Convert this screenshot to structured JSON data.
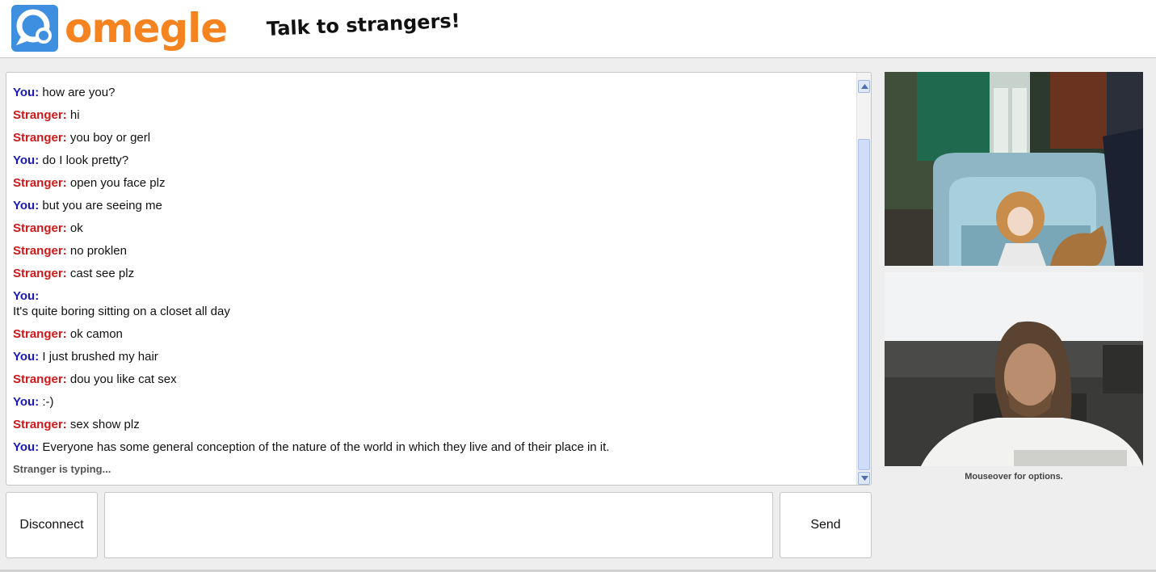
{
  "header": {
    "logo_text": "omegle",
    "tagline": "Talk to strangers!"
  },
  "chat": {
    "messages": [
      {
        "sender": "You:",
        "role": "you",
        "text": "how are you?"
      },
      {
        "sender": "Stranger:",
        "role": "stranger",
        "text": "hi"
      },
      {
        "sender": "Stranger:",
        "role": "stranger",
        "text": "you boy or gerl"
      },
      {
        "sender": "You:",
        "role": "you",
        "text": "do I look pretty?"
      },
      {
        "sender": "Stranger:",
        "role": "stranger",
        "text": "open you face plz"
      },
      {
        "sender": "You:",
        "role": "you",
        "text": "but you are seeing me"
      },
      {
        "sender": "Stranger:",
        "role": "stranger",
        "text": "ok"
      },
      {
        "sender": "Stranger:",
        "role": "stranger",
        "text": "no proklen"
      },
      {
        "sender": "Stranger:",
        "role": "stranger",
        "text": "cast see plz"
      },
      {
        "sender": "You:",
        "role": "you",
        "text": "It's quite boring sitting on a closet all day",
        "multiline": true
      },
      {
        "sender": "Stranger:",
        "role": "stranger",
        "text": "ok camon"
      },
      {
        "sender": "You:",
        "role": "you",
        "text": "I just brushed my hair"
      },
      {
        "sender": "Stranger:",
        "role": "stranger",
        "text": "dou you like cat sex"
      },
      {
        "sender": "You:",
        "role": "you",
        "text": ":-)"
      },
      {
        "sender": "Stranger:",
        "role": "stranger",
        "text": "sex show plz"
      },
      {
        "sender": "You:",
        "role": "you",
        "text": "Everyone has some general conception of the nature of the world in which they live and of their place in it."
      }
    ],
    "typing_status": "Stranger is typing..."
  },
  "controls": {
    "disconnect_label": "Disconnect",
    "send_label": "Send",
    "input_value": ""
  },
  "video": {
    "hint": "Mouseover for options."
  },
  "colors": {
    "you": "#1a1ab8",
    "stranger": "#d01818",
    "logo_orange": "#f48320",
    "logo_blue": "#3f8fe0"
  }
}
